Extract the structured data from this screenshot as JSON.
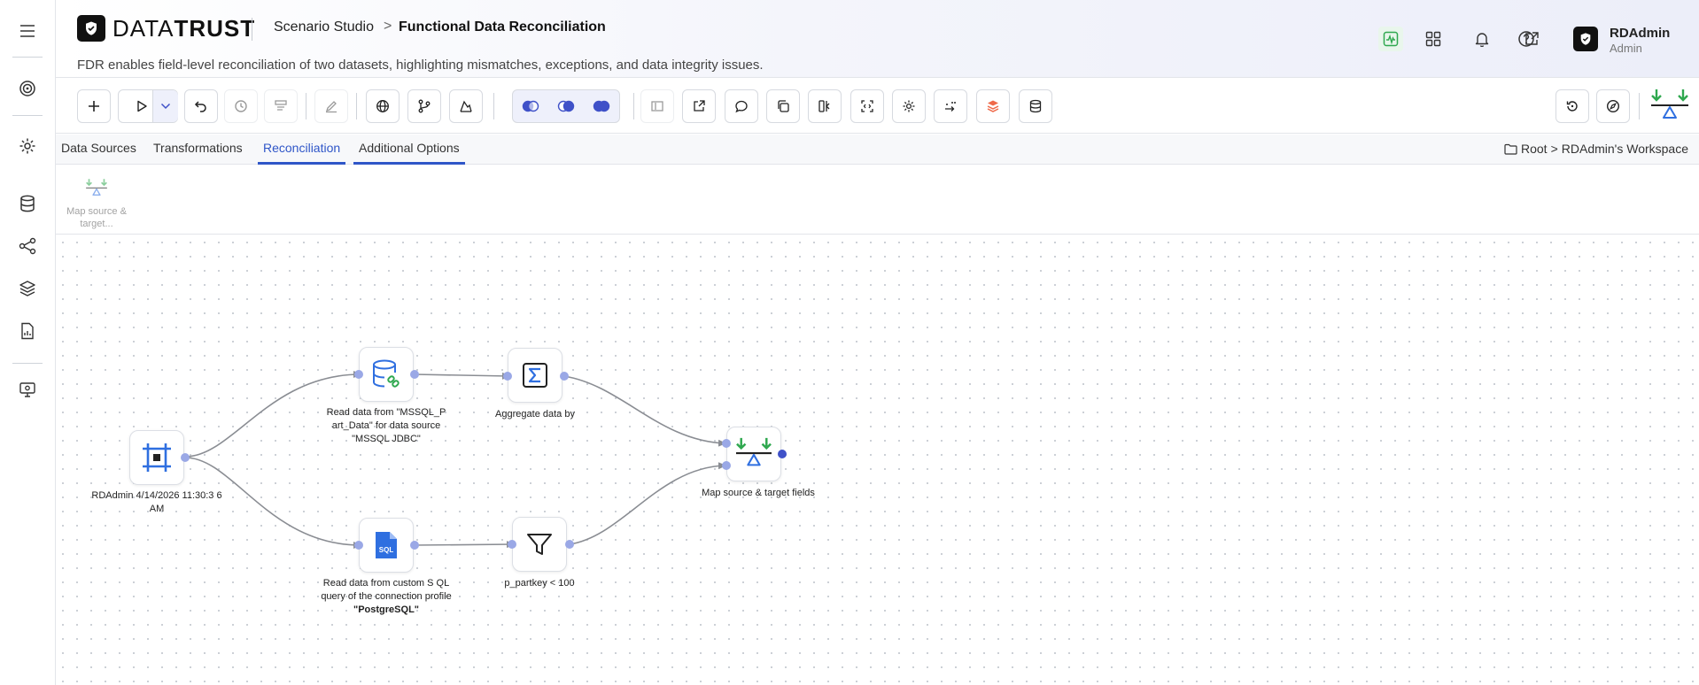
{
  "app": {
    "logo_light": "DATA",
    "logo_bold": "TRUST",
    "breadcrumb_parent": "Scenario Studio",
    "breadcrumb_sep": ">",
    "breadcrumb_current": "Functional Data Reconciliation",
    "subtitle": "FDR enables field-level reconciliation of two datasets, highlighting mismatches, exceptions, and data integrity issues."
  },
  "user": {
    "name": "RDAdmin",
    "role": "Admin"
  },
  "rail_icons": [
    "menu-icon",
    "target-icon",
    "gear-icon",
    "database-icon",
    "graph-icon",
    "layers-icon",
    "report-icon",
    "monitor-settings-icon"
  ],
  "header_icons": [
    "activity-icon",
    "apps-grid-icon",
    "bell-icon",
    "external-link-icon",
    "help-icon"
  ],
  "tabs": [
    {
      "label": "Data Sources"
    },
    {
      "label": "Transformations"
    },
    {
      "label": "Reconciliation"
    },
    {
      "label": "Additional Options"
    }
  ],
  "workspace": {
    "root": "Root",
    "sep": ">",
    "name": "RDAdmin's Workspace"
  },
  "palette": {
    "label": "Map source & target..."
  },
  "nodes": {
    "start": {
      "label": "RDAdmin 4/14/2026 11:30:3 6 AM"
    },
    "read_mssql": {
      "label": "Read data from \"MSSQL_P art_Data\" for data source \"MSSQL JDBC\""
    },
    "aggregate": {
      "label": "Aggregate data by"
    },
    "read_sql": {
      "label_prefix": "Read data from custom S QL query of the connection profile ",
      "label_bold": "\"PostgreSQL\""
    },
    "filter": {
      "label": "p_partkey < 100"
    },
    "map": {
      "label": "Map source & target fields"
    }
  },
  "colors": {
    "accent": "#2f56c8",
    "port": "#9aa8e6",
    "green": "#2fa84f",
    "sql_blue": "#2f6fe0"
  }
}
